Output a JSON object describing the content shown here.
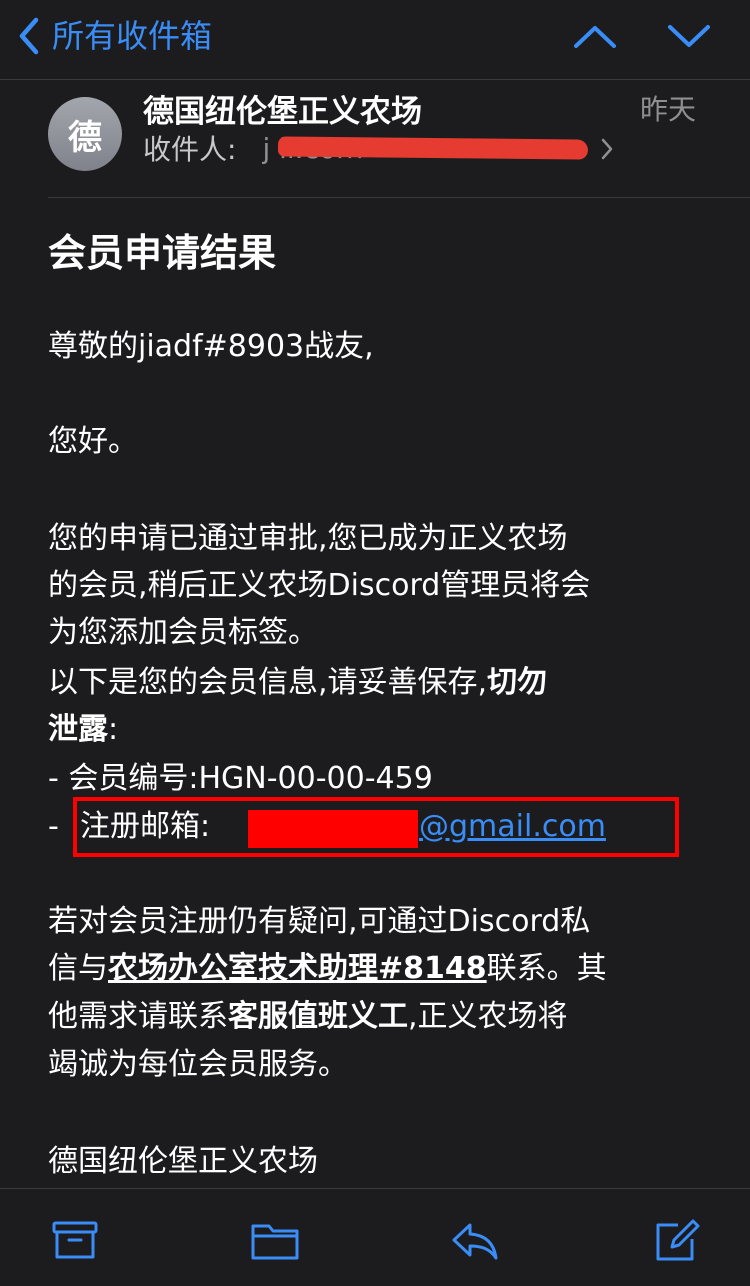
{
  "nav": {
    "back_label": "所有收件箱"
  },
  "header": {
    "avatar_letter": "德",
    "sender": "德国纽伦堡正义农场",
    "date": "昨天",
    "recipient_label": "收件人:",
    "recipient_value": "j                         il.com"
  },
  "email": {
    "subject": "会员申请结果",
    "greeting": "尊敬的jiadf#8903战友,",
    "hello": "您好。",
    "para1_line1": "您的申请已通过审批,您已成为正义农场",
    "para1_line2": "的会员,稍后正义农场Discord管理员将会",
    "para1_line3": "为您添加会员标签。",
    "para2_line1_plain": "以下是您的会员信息,请妥善保存,",
    "para2_line1_bold": "切勿",
    "para2_line2_bold": "泄露",
    "para2_line2_tail": ":",
    "member_id_line": "-  会员编号:HGN-00-00-459",
    "email_dash": "-",
    "email_label": "注册邮箱:",
    "email_link": "@gmail.com",
    "para3_line1": "若对会员注册仍有疑问,可通过Discord私",
    "para3_line2_pre": "信与",
    "para3_line2_link": "农场办公室技术助理#8148",
    "para3_line2_post": "联系。其",
    "para3_line3_pre": "他需求请联系",
    "para3_line3_bold": "客服值班义工",
    "para3_line3_post": ",正义农场将",
    "para3_line4": "竭诚为每位会员服务。",
    "signature": "德国纽伦堡正义农场"
  },
  "icons": {
    "back": "chevron-left-icon",
    "up": "chevron-up-icon",
    "down": "chevron-down-icon",
    "archive": "archive-icon",
    "folder": "folder-icon",
    "reply": "reply-icon",
    "compose": "compose-icon"
  },
  "colors": {
    "accent": "#3a8df6",
    "background": "#1c1c1e",
    "redaction": "#ff0000"
  }
}
